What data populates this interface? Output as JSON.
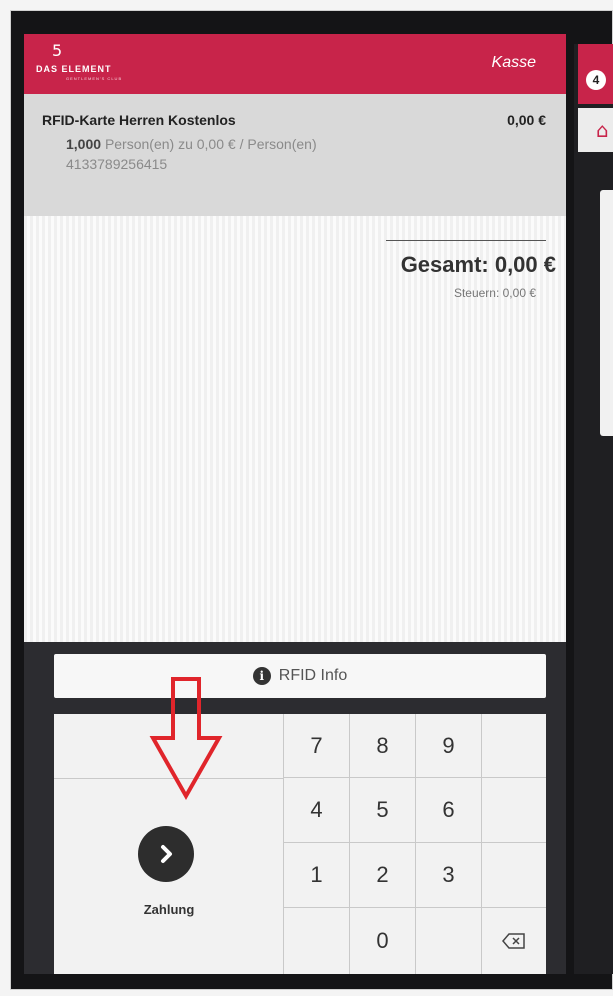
{
  "header": {
    "logo_text": "DAS ELEMENT",
    "logo_subtext": "GENTLEMEN'S CLUB",
    "title": "Kasse"
  },
  "receipt": {
    "item": {
      "name": "RFID-Karte Herren Kostenlos",
      "price": "0,00 €",
      "quantity": "1,000",
      "detail": "Person(en) zu 0,00 € / Person(en)",
      "code": "4133789256415"
    },
    "total": "Gesamt: 0,00 €",
    "tax": "Steuern: 0,00 €"
  },
  "rfid_button": {
    "label": "RFID Info",
    "icon": "info-icon"
  },
  "payment": {
    "label": "Zahlung",
    "icon": "chevron-right-icon"
  },
  "keypad": {
    "keys": [
      "7",
      "8",
      "9",
      "",
      "4",
      "5",
      "6",
      "",
      "1",
      "2",
      "3",
      "",
      "",
      "0",
      "",
      "⌫"
    ]
  },
  "side": {
    "badge": "4",
    "home_icon": "home-icon"
  },
  "colors": {
    "brand": "#c8244a",
    "annotation": "#e0252b",
    "dark": "#2d2d2d"
  }
}
